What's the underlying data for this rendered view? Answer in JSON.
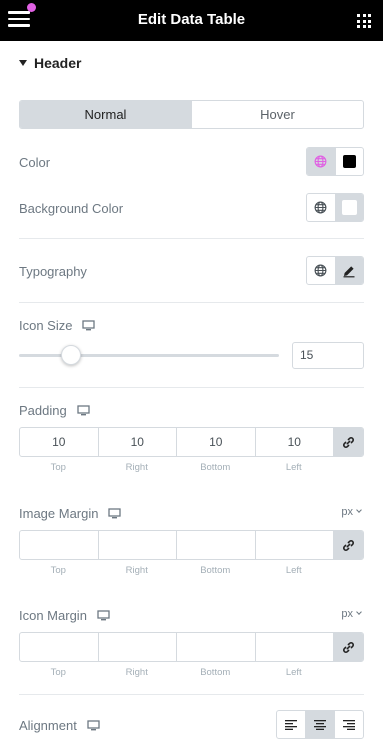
{
  "header": {
    "title": "Edit Data Table"
  },
  "section": {
    "title": "Header"
  },
  "tabs": [
    {
      "label": "Normal",
      "active": true
    },
    {
      "label": "Hover",
      "active": false
    }
  ],
  "fields": {
    "color": {
      "label": "Color",
      "value": "#000000"
    },
    "background_color": {
      "label": "Background Color",
      "value": "#ffffff"
    },
    "typography": {
      "label": "Typography"
    },
    "icon_size": {
      "label": "Icon Size",
      "value": "15",
      "slider_fraction": 0.2
    },
    "padding": {
      "label": "Padding",
      "values": [
        "10",
        "10",
        "10",
        "10"
      ],
      "sides": [
        "Top",
        "Right",
        "Bottom",
        "Left"
      ]
    },
    "image_margin": {
      "label": "Image Margin",
      "unit": "px",
      "values": [
        "",
        "",
        "",
        ""
      ],
      "sides": [
        "Top",
        "Right",
        "Bottom",
        "Left"
      ]
    },
    "icon_margin": {
      "label": "Icon Margin",
      "unit": "px",
      "values": [
        "",
        "",
        "",
        ""
      ],
      "sides": [
        "Top",
        "Right",
        "Bottom",
        "Left"
      ]
    },
    "alignment": {
      "label": "Alignment",
      "options": [
        "left",
        "center",
        "right"
      ],
      "selected": "center"
    }
  },
  "colors": {
    "accent": "#e061e3",
    "border": "#d5dadf",
    "label": "#6d7882"
  },
  "icons": {
    "menu": "hamburger-icon",
    "apps": "grid-icon",
    "global": "globe-icon",
    "edit": "pencil-icon",
    "device": "monitor-icon",
    "link": "link-icon"
  }
}
